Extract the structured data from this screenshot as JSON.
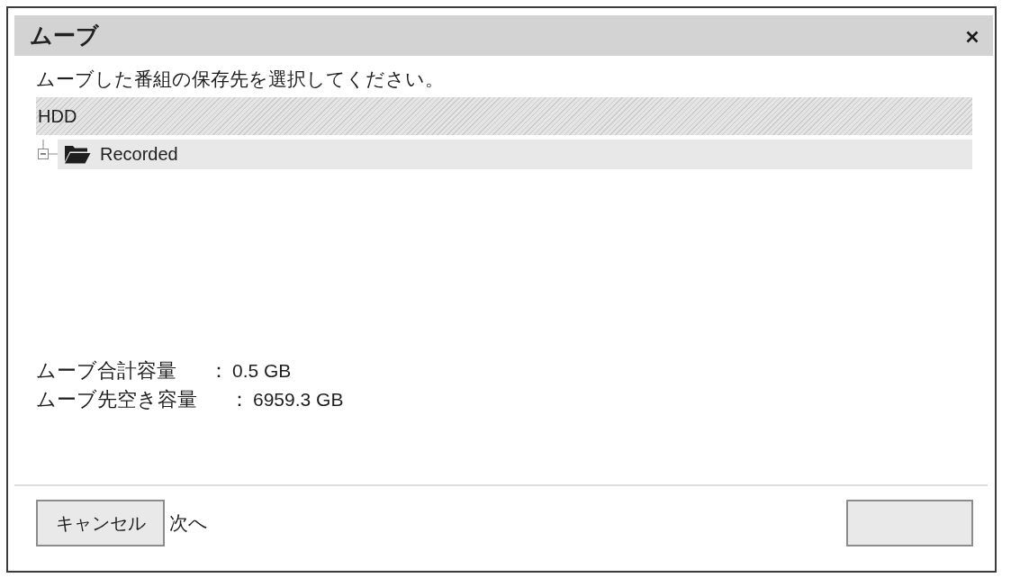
{
  "window": {
    "title": "ムーブ"
  },
  "instruction": "ムーブした番組の保存先を選択してください。",
  "tree": [
    {
      "label": "HDD",
      "kind": "drive",
      "selected": false,
      "disabled": true,
      "children": [
        {
          "label": "Recorded",
          "kind": "folder",
          "selected": true,
          "disabled": false,
          "expanded": true
        }
      ]
    }
  ],
  "summary": [
    {
      "label": "ムーブ合計容量",
      "separator": "：",
      "value": "0.5 GB"
    },
    {
      "label": "ムーブ先空き容量",
      "separator": "：",
      "value": "6959.3 GB"
    }
  ],
  "footer": {
    "cancel_button": "キャンセル",
    "next_label": "次へ"
  }
}
